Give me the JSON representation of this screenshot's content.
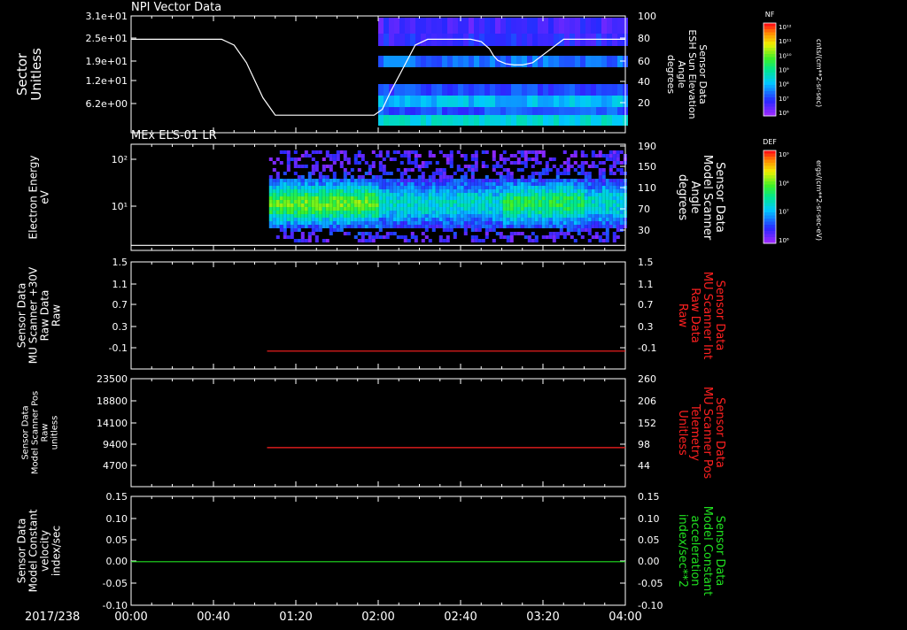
{
  "time_axis": {
    "date_label": "2017/238",
    "ticks": [
      "00:00",
      "00:40",
      "01:20",
      "02:00",
      "02:40",
      "03:20",
      "04:00"
    ],
    "range_minutes": [
      0,
      240
    ]
  },
  "colorbars": [
    {
      "label": "NF",
      "unit": "cnts/(cm**2-sr-sec)",
      "tick_labels": [
        "10¹²",
        "10¹¹",
        "10¹⁰",
        "10⁹",
        "10⁸",
        "10⁷",
        "10⁶"
      ],
      "scale": "log"
    },
    {
      "label": "DEF",
      "unit": "ergs/(cm**2-sr-sec-eV)",
      "tick_labels": [
        "10⁹",
        "10⁸",
        "10⁷",
        "10⁶"
      ],
      "scale": "log"
    }
  ],
  "chart_data": [
    {
      "type": "heatmap",
      "title": "NPI Vector Data",
      "ylabel_left": [
        "Sector",
        "Unitless"
      ],
      "left_ticks": [
        "3.1e+01",
        "2.5e+01",
        "1.9e+01",
        "1.2e+01",
        "6.2e+00"
      ],
      "ylabel_right": [
        "Sensor Data",
        "ESH Sun Elevation",
        "Angle",
        "degrees"
      ],
      "right_ticks": [
        "100",
        "80",
        "60",
        "40",
        "20"
      ],
      "right_ylim": [
        0,
        100
      ],
      "data_start_minute": 120,
      "overlay_line": {
        "axis": "right",
        "x_minutes": [
          0,
          44,
          50,
          56,
          60,
          64,
          70,
          118,
          122,
          126,
          132,
          138,
          144,
          150,
          165,
          170,
          174,
          176,
          178,
          182,
          186,
          190,
          195,
          210,
          240
        ],
        "y": [
          80,
          80,
          75,
          60,
          45,
          30,
          15,
          15,
          20,
          35,
          55,
          75,
          80,
          80,
          80,
          78,
          72,
          66,
          62,
          59,
          58,
          58,
          60,
          80,
          80
        ]
      }
    },
    {
      "type": "heatmap",
      "title": "MEx ELS-01 LR",
      "ylabel_left": [
        "Electron Energy",
        "eV"
      ],
      "left_ticks": [
        "10²",
        "10¹"
      ],
      "ylabel_right": [
        "Sensor Data",
        "Model Scanner",
        "Angle",
        "degrees"
      ],
      "right_ticks": [
        "190",
        "150",
        "110",
        "70",
        "30"
      ],
      "right_ylim": [
        0,
        190
      ],
      "data_start_minute": 67,
      "overlay_line": {
        "axis": "right",
        "x_minutes": [
          0,
          240
        ],
        "y": [
          9,
          9
        ]
      }
    },
    {
      "type": "line",
      "ylabel_left": [
        "Sensor Data",
        "MU Scanner +30V",
        "Raw Data",
        "Raw"
      ],
      "left_ticks": [
        "1.5",
        "1.1",
        "0.7",
        "0.3",
        "-0.1"
      ],
      "ylabel_right": [
        "Sensor Data",
        "MU Scanner Int",
        "Raw Data",
        "Raw"
      ],
      "right_ticks": [
        "1.5",
        "1.1",
        "0.7",
        "0.3",
        "-0.1"
      ],
      "ylim": [
        -0.3,
        1.5
      ],
      "series": [
        {
          "axis": "left",
          "color": "#ff2020",
          "x_minutes": [
            66,
            240
          ],
          "y": [
            0.0,
            0.0
          ]
        }
      ]
    },
    {
      "type": "line",
      "ylabel_left": [
        "Sensor Data",
        "Model Scanner Pos",
        "Raw",
        "unitless"
      ],
      "left_ticks": [
        "23500",
        "18800",
        "14100",
        "9400",
        "4700"
      ],
      "ylabel_right": [
        "Sensor Data",
        "MU Scanner Pos",
        "Telemetry",
        "Unitless"
      ],
      "right_ticks": [
        "260",
        "206",
        "152",
        "98",
        "44"
      ],
      "ylim": [
        0,
        23500
      ],
      "series": [
        {
          "axis": "left",
          "color": "#ff2020",
          "x_minutes": [
            66,
            240
          ],
          "y": [
            8500,
            8500
          ]
        }
      ]
    },
    {
      "type": "line",
      "ylabel_left": [
        "Sensor Data",
        "Model Constant",
        "velocity",
        "index/sec"
      ],
      "left_ticks": [
        "0.15",
        "0.10",
        "0.05",
        "0.00",
        "-0.05",
        "-0.10"
      ],
      "ylabel_right": [
        "Sensor Data",
        "Model Constant",
        "acceleration",
        "index/sec**2"
      ],
      "right_ticks": [
        "0.15",
        "0.10",
        "0.05",
        "0.00",
        "-0.05",
        "-0.10"
      ],
      "ylim": [
        -0.1,
        0.15
      ],
      "series": [
        {
          "axis": "left",
          "color": "#20e020",
          "x_minutes": [
            0,
            240
          ],
          "y": [
            0.0,
            0.0
          ]
        }
      ]
    }
  ]
}
